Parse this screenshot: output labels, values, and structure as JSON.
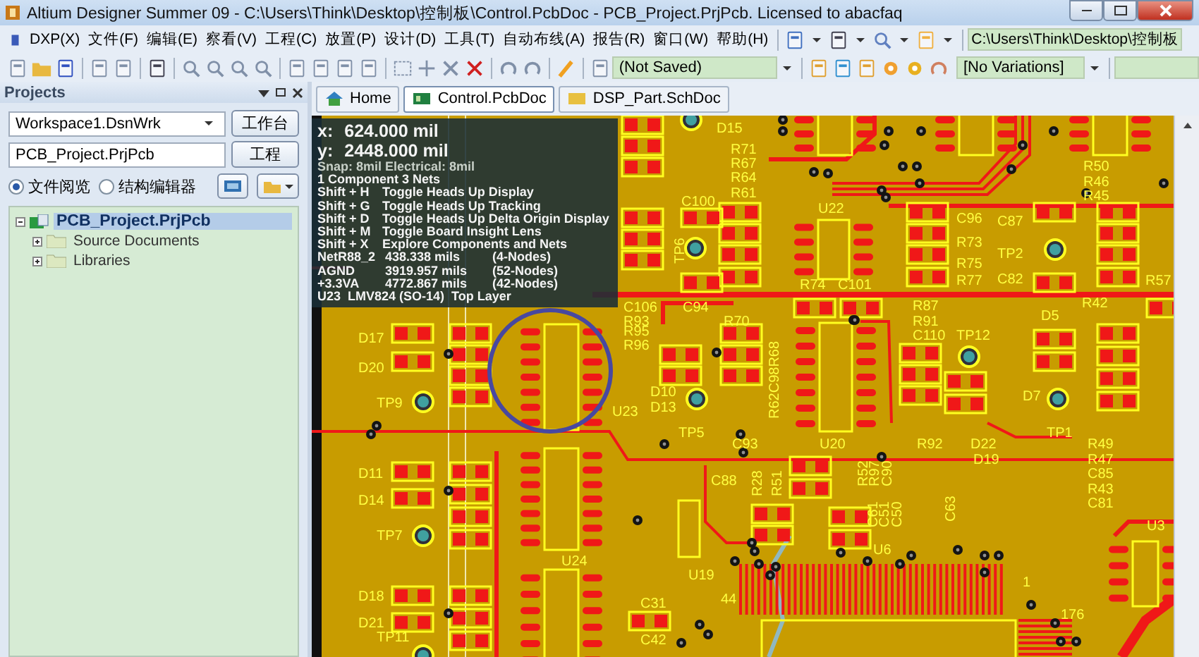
{
  "window": {
    "title": "Altium Designer Summer 09 - C:\\Users\\Think\\Desktop\\控制板\\Control.PcbDoc - PCB_Project.PrjPcb. Licensed to abacfaq"
  },
  "menu": [
    "DXP(X)",
    "文件(F)",
    "编辑(E)",
    "察看(V)",
    "工程(C)",
    "放置(P)",
    "设计(D)",
    "工具(T)",
    "自动布线(A)",
    "报告(R)",
    "窗口(W)",
    "帮助(H)"
  ],
  "path_field": {
    "value": "C:\\Users\\Think\\Desktop\\控制板"
  },
  "toolbar": {
    "document_state": "(Not Saved)",
    "variations": "[No Variations]"
  },
  "projects_panel": {
    "title": "Projects",
    "workspace": "Workspace1.DsnWrk",
    "workspace_button": "工作台",
    "project": "PCB_Project.PrjPcb",
    "project_button": "工程",
    "view_modes": [
      {
        "label": "文件阅览",
        "selected": true
      },
      {
        "label": "结构编辑器",
        "selected": false
      }
    ],
    "tree": [
      {
        "label": "PCB_Project.PrjPcb",
        "selected": true,
        "expanded": true,
        "children": [
          {
            "label": "Source Documents",
            "selected": false,
            "expanded": false
          },
          {
            "label": "Libraries",
            "selected": false,
            "expanded": false
          }
        ]
      }
    ]
  },
  "doc_tabs": [
    {
      "label": "Home",
      "selected": false,
      "kind": "home"
    },
    {
      "label": "Control.PcbDoc",
      "selected": true,
      "kind": "pcb"
    },
    {
      "label": "DSP_Part.SchDoc",
      "selected": false,
      "kind": "sch"
    }
  ],
  "heads_up": {
    "coords": [
      {
        "axis": "x:",
        "value": "624.000 mil"
      },
      {
        "axis": "y:",
        "value": "2448.000 mil"
      }
    ],
    "snap": "Snap: 8mil Electrical: 8mil",
    "summary": "1 Component 3 Nets",
    "shortcuts": [
      {
        "keys": "Shift + H",
        "action": "Toggle Heads Up Display"
      },
      {
        "keys": "Shift + G",
        "action": "Toggle Heads Up Tracking"
      },
      {
        "keys": "Shift + D",
        "action": "Toggle Heads Up Delta Origin Display"
      },
      {
        "keys": "Shift + M",
        "action": "Toggle Board Insight Lens"
      },
      {
        "keys": "Shift + X",
        "action": "Explore Components and Nets"
      }
    ],
    "nets": [
      {
        "name": "NetR88_2",
        "length": "438.338 mils",
        "nodes": "(4-Nodes)"
      },
      {
        "name": "AGND",
        "length": "3919.957 mils",
        "nodes": "(52-Nodes)"
      },
      {
        "name": "+3.3VA",
        "length": "4772.867 mils",
        "nodes": "(42-Nodes)"
      }
    ],
    "component": "U23  LMV824 (SO-14)  Top Layer"
  },
  "board": {
    "labels": [
      "D15",
      "R71",
      "R67",
      "R64",
      "C100",
      "R61",
      "U22",
      "C96",
      "C87",
      "R73",
      "TP2",
      "R75",
      "R77",
      "C82",
      "R50",
      "R46",
      "R45",
      "TP6",
      "R74",
      "C101",
      "C106",
      "C94",
      "R93",
      "R70",
      "R95",
      "R96",
      "R87",
      "R91",
      "C110",
      "TP12",
      "D5",
      "R42",
      "R57",
      "R62C98R68",
      "D17",
      "D20",
      "TP9",
      "U23",
      "D10",
      "D13",
      "TP5",
      "C93",
      "U20",
      "R92",
      "D22",
      "D19",
      "D7",
      "TP1",
      "R49",
      "R47",
      "C85",
      "R43",
      "C81",
      "D11",
      "D14",
      "TP7",
      "C88",
      "R28",
      "R51",
      "R52",
      "R97",
      "C90",
      "C61",
      "C51",
      "C50",
      "C63",
      "U6",
      "U3",
      "U19",
      "U24",
      "44",
      "1",
      "176",
      "C31",
      "C42",
      "D18",
      "D21",
      "TP11"
    ]
  }
}
